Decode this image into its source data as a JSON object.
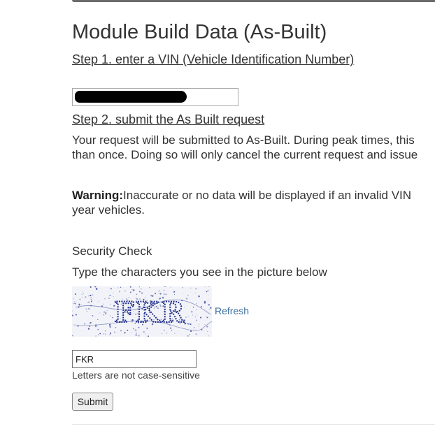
{
  "page": {
    "title": "Module Build Data (As-Built)",
    "step1": "Step 1. enter a VIN (Vehicle Identification Number)",
    "step2": "Step 2. submit the As Built request",
    "info_line1": "Your request will be submitted to As-Built. During peak times, this",
    "info_line2": "than once. Doing so will only cancel the current request and issue",
    "warning_label": "Warning:",
    "warning_line1": "Inaccurate or no data will be displayed if an invalid VIN",
    "warning_line2": "year vehicles."
  },
  "vin": {
    "value": ""
  },
  "security": {
    "heading": "Security Check",
    "instruction": "Type the characters you see in the picture below",
    "captcha_text": "FKR",
    "refresh_label": "Refresh",
    "input_value": "FKR",
    "hint": "Letters are not case-sensitive",
    "submit_label": "Submit"
  },
  "colors": {
    "captcha_ink": "#1f2d8a",
    "link": "#3a6fa0"
  }
}
